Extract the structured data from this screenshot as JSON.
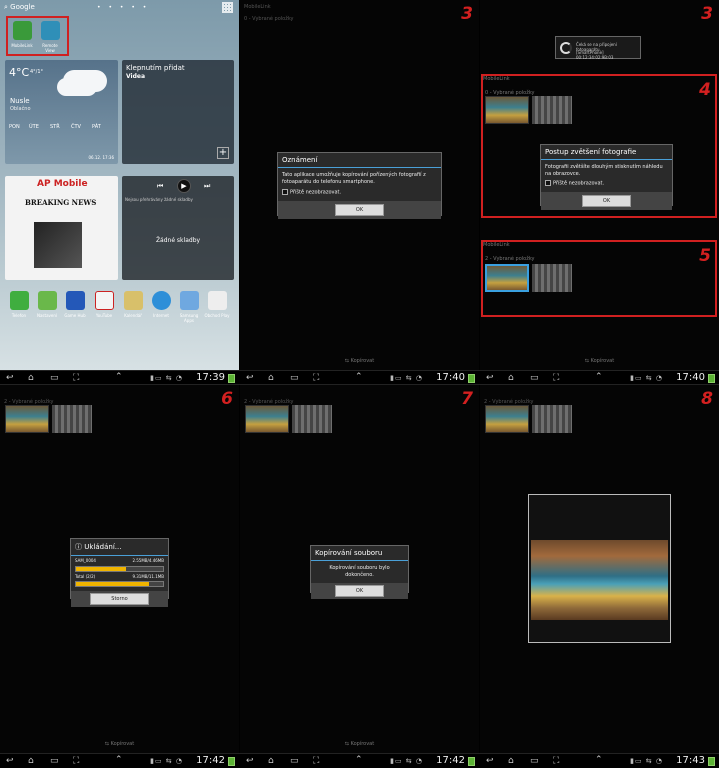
{
  "panel1": {
    "search_label": "Google",
    "shortcuts": [
      "MobileLink",
      "Remote View"
    ],
    "weather": {
      "temp": "4°C",
      "range": "4°/1°",
      "city": "Nusle",
      "condition": "Oblačno",
      "days": [
        "PON",
        "ÚTE",
        "STŘ",
        "ČTV",
        "PÁT"
      ],
      "date": "06.12. 17:36"
    },
    "video_widget": {
      "title": "Klepnutím přidat",
      "subtitle": "Videa"
    },
    "news": {
      "brand": "AP Mobile",
      "headline": "BREAKING NEWS"
    },
    "music": {
      "status": "Nejsou přehrávány žádné skladby",
      "empty": "Žádné skladby"
    },
    "apps": [
      "Telefon",
      "Nastavení",
      "Game Hub",
      "YouTube",
      "Kalendář",
      "Internet",
      "Samsung Apps",
      "Obchod Play"
    ]
  },
  "panel2": {
    "step": "3",
    "header": "MobileLink",
    "subheader": "0 - Vybrané položky",
    "dialog": {
      "title": "Oznámení",
      "body": "Tato aplikace umožňuje kopírování pořízených fotografií z fotoaparátu do telefonu smartphone.",
      "checkbox": "Příště nezobrazovat.",
      "ok": "OK"
    },
    "footer": "Kopírovat"
  },
  "panel3": {
    "step": "3",
    "toast": {
      "line1": "Čeká se na připojení fotoaparátu.",
      "line2": "[SmartPhone] 00:12:34:02:9B:03"
    },
    "step4": "4",
    "header4": "MobileLink",
    "sub4": "0 - Vybrané položky",
    "dialog": {
      "title": "Postup zvětšení fotografie",
      "body": "Fotografii zvětšíte dlouhým stisknutím náhledu na obrazovce.",
      "checkbox": "Příště nezobrazovat.",
      "ok": "OK"
    },
    "step5": "5",
    "header5": "MobileLink",
    "sub5": "2 - Vybrané položky",
    "footer": "Kopírovat"
  },
  "panel4": {
    "step": "6",
    "subheader": "2 - Vybrané položky",
    "dialog": {
      "title": "Ukládání...",
      "row1_left": "SAM_0004",
      "row1_right": "2.55MB/4.46MB",
      "row1_pct": 0.57,
      "row2_left": "Total (2/2)",
      "row2_right": "9.31MB/11.1MB",
      "row2_pct": 0.84,
      "cancel": "Storno"
    },
    "footer": "Kopírovat"
  },
  "panel5": {
    "step": "7",
    "subheader": "2 - Vybrané položky",
    "dialog": {
      "title": "Kopírování souboru",
      "body": "Kopírování souboru bylo dokončeno.",
      "ok": "OK"
    },
    "footer": "Kopírovat"
  },
  "panel6": {
    "step": "8",
    "subheader": "2 - Vybrané položky"
  },
  "navbars": {
    "times_top": [
      "17:39",
      "17:40",
      "17:40"
    ],
    "times_bottom": [
      "17:42",
      "17:42",
      "17:43"
    ]
  }
}
